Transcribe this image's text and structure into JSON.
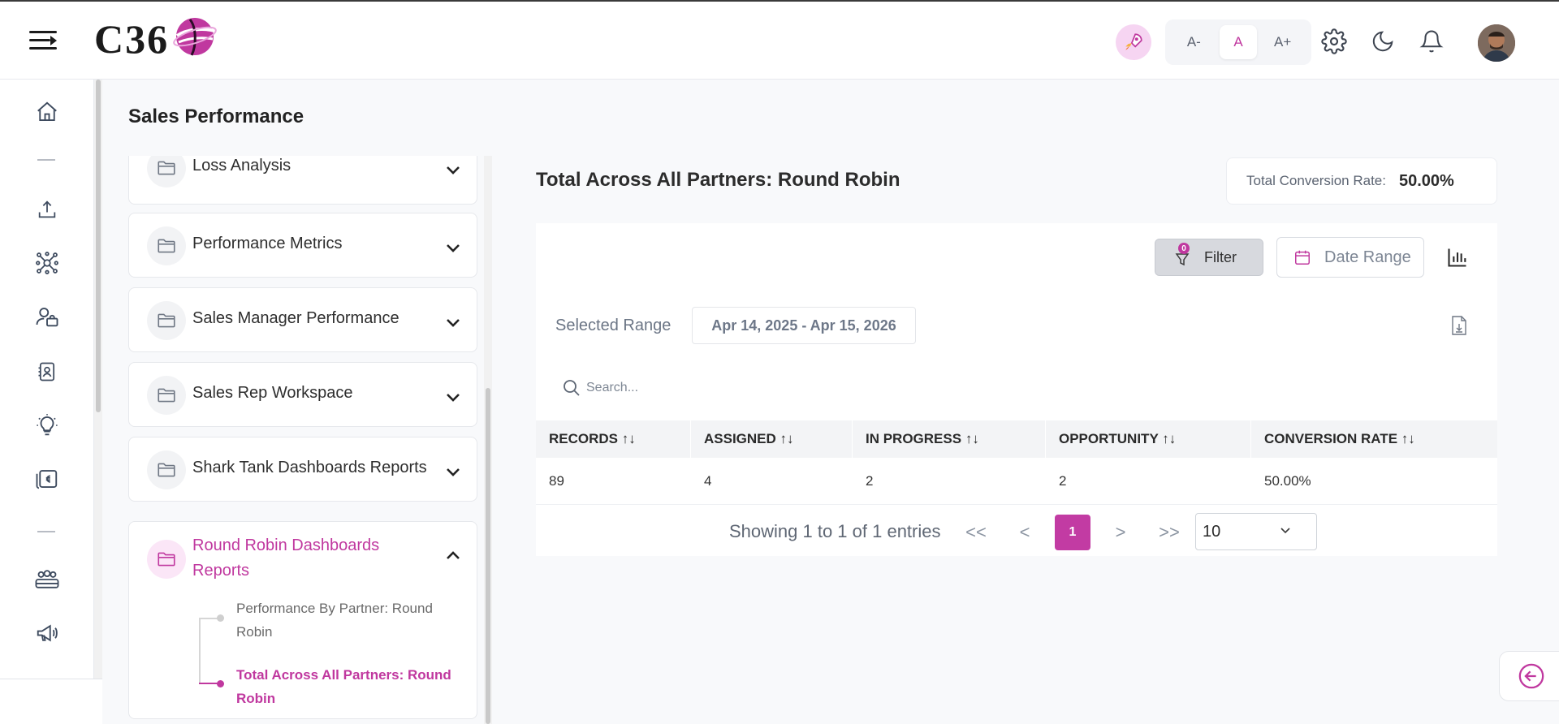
{
  "header": {
    "logo_text": "C36",
    "font_size_buttons": [
      "A-",
      "A",
      "A+"
    ],
    "icons": [
      "menu-icon",
      "rocket-icon",
      "gear-icon",
      "moon-icon",
      "bell-icon",
      "avatar"
    ]
  },
  "rail": {
    "items": [
      "home-icon",
      "upload-icon",
      "network-icon",
      "users-icon",
      "badge-icon",
      "lightbulb-icon",
      "cash-icon",
      "team-icon",
      "megaphone-icon"
    ]
  },
  "page": {
    "title": "Sales Performance"
  },
  "folders": [
    {
      "label": "Loss Analysis",
      "open": false
    },
    {
      "label": "Performance Metrics",
      "open": false
    },
    {
      "label": "Sales Manager Performance",
      "open": false
    },
    {
      "label": "Sales Rep Workspace",
      "open": false
    },
    {
      "label": "Shark Tank Dashboards Reports",
      "open": false
    },
    {
      "label": "Round Robin Dashboards Reports",
      "open": true,
      "children": [
        {
          "label": "Performance By Partner: Round Robin",
          "active": false
        },
        {
          "label": "Total Across All Partners: Round Robin",
          "active": true
        }
      ]
    }
  ],
  "report": {
    "title": "Total Across All Partners: Round Robin",
    "conversion_label": "Total Conversion Rate:",
    "conversion_value": "50.00%",
    "filter_label": "Filter",
    "filter_count": "0",
    "date_range_label": "Date Range",
    "selected_range_label": "Selected Range",
    "selected_range_value": "Apr 14, 2025 - Apr 15, 2026",
    "search_placeholder": "Search...",
    "columns": [
      "RECORDS",
      "ASSIGNED",
      "IN PROGRESS",
      "OPPORTUNITY",
      "CONVERSION RATE"
    ],
    "rows": [
      [
        "89",
        "4",
        "2",
        "2",
        "50.00%"
      ]
    ],
    "pagination": {
      "info": "Showing 1 to 1 of 1 entries",
      "first": "<<",
      "prev": "<",
      "current": "1",
      "next": ">",
      "last": ">>",
      "page_size": "10"
    }
  },
  "colors": {
    "accent": "#c0389f",
    "accent_light": "#fbe6f7",
    "text": "#2b2b2b",
    "muted": "#6b7585"
  }
}
